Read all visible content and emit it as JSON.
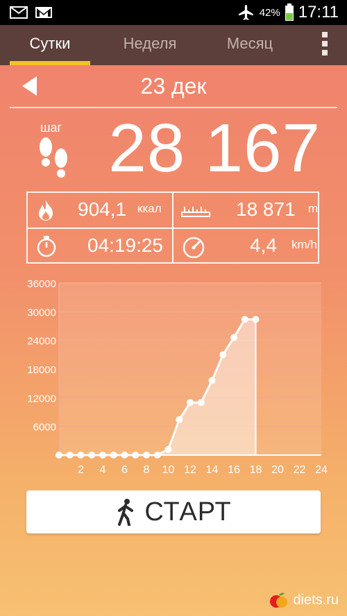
{
  "status_bar": {
    "battery": "42%",
    "time": "17:11",
    "icons": [
      "mail-icon",
      "gmail-icon",
      "airplane-mode-icon",
      "battery-icon"
    ]
  },
  "tabs": [
    {
      "label": "Сутки",
      "active": true
    },
    {
      "label": "Неделя",
      "active": false
    },
    {
      "label": "Месяц",
      "active": false
    }
  ],
  "date": "23 дек",
  "steps": {
    "label": "шаг",
    "value": "28 167"
  },
  "stats": {
    "calories": {
      "value": "904,1",
      "unit": "ккал"
    },
    "distance": {
      "value": "18 871",
      "unit": "m"
    },
    "duration": {
      "value": "04:19:25"
    },
    "speed": {
      "value": "4,4",
      "unit": "km/h"
    }
  },
  "chart_data": {
    "type": "area",
    "x": [
      0,
      1,
      2,
      3,
      4,
      5,
      6,
      7,
      8,
      9,
      10,
      11,
      12,
      13,
      14,
      15,
      16,
      17,
      18
    ],
    "y": [
      0,
      0,
      0,
      0,
      0,
      0,
      0,
      0,
      0,
      0,
      1200,
      7400,
      11000,
      11000,
      15600,
      21000,
      24600,
      28400,
      28400
    ],
    "x_ticks": [
      "2",
      "4",
      "6",
      "8",
      "10",
      "12",
      "14",
      "16",
      "18",
      "20",
      "22",
      "24"
    ],
    "y_ticks": [
      "6000",
      "12000",
      "18000",
      "24000",
      "30000",
      "36000"
    ],
    "xlim": [
      0,
      24
    ],
    "ylim": [
      0,
      36000
    ],
    "grid": true
  },
  "start_button": {
    "label": "СТАРТ"
  },
  "watermark": "diets.ru",
  "colors": {
    "tab_bar": "#5c3f3a",
    "tab_indicator": "#f6c024",
    "grid": "#f4a987"
  }
}
